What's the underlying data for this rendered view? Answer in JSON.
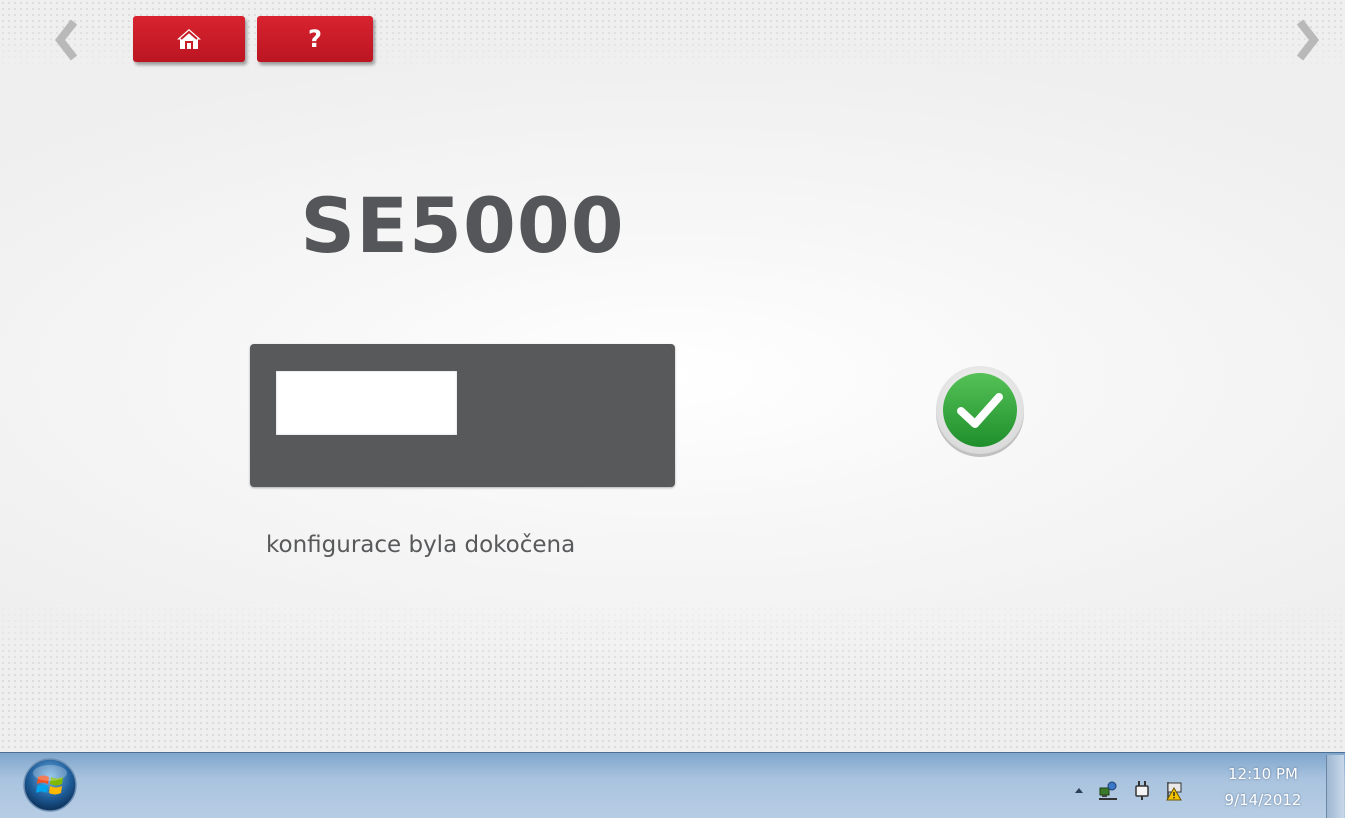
{
  "app": {
    "device_title": "SE5000",
    "status_message": "konfigurace byla dokočena",
    "display_window_text": "",
    "toolbar": {
      "home_icon": "home-icon",
      "help_label": "?"
    },
    "nav": {
      "prev_icon": "chevron-left-icon",
      "next_icon": "chevron-right-icon"
    },
    "result_icon": "checkmark-success-icon",
    "colors": {
      "button_red": "#c81b27",
      "panel_gray": "#58595b",
      "text_gray": "#555659",
      "success_green": "#2ea83a"
    }
  },
  "taskbar": {
    "start_icon": "windows-start-orb",
    "tray_icons": [
      "show-hidden-icons-chevron",
      "network-icon",
      "power-icon",
      "action-center-icon"
    ],
    "clock_time": "12:10 PM",
    "clock_date": "9/14/2012"
  }
}
